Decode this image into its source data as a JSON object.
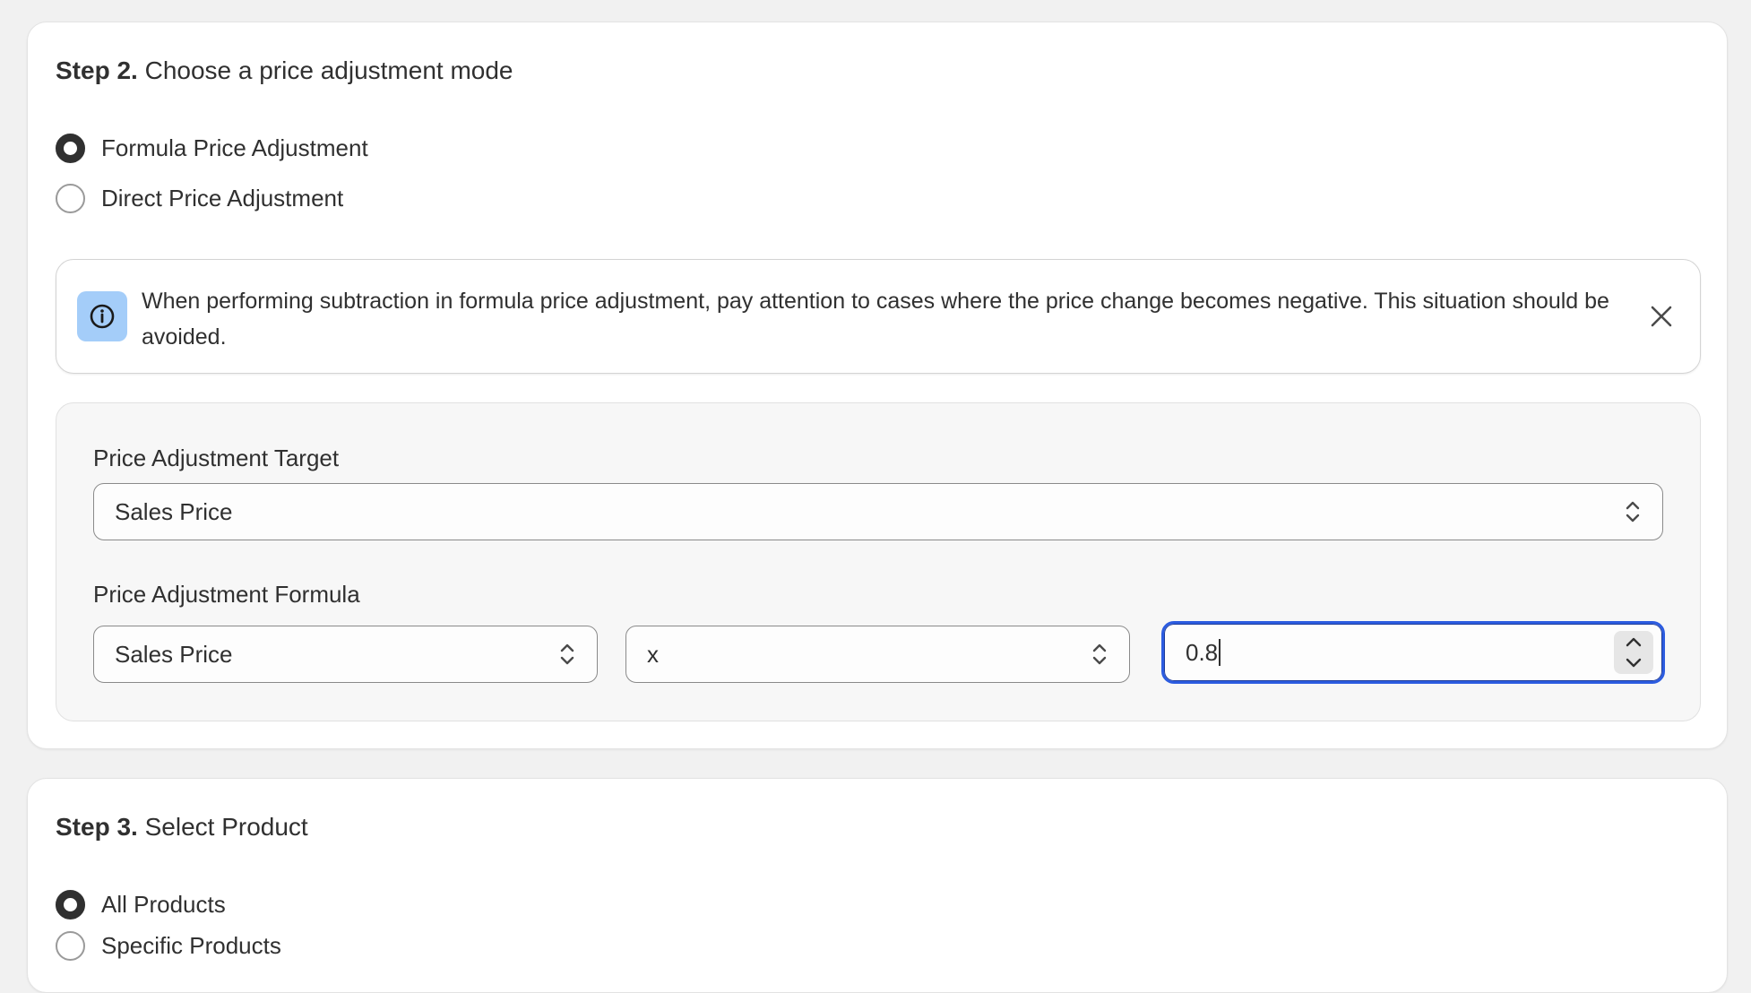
{
  "step2": {
    "number": "Step 2.",
    "title": "Choose a price adjustment mode",
    "options": [
      {
        "label": "Formula Price Adjustment",
        "checked": true
      },
      {
        "label": "Direct Price Adjustment",
        "checked": false
      }
    ],
    "banner": {
      "icon": "info-icon",
      "text": "When performing subtraction in formula price adjustment, pay attention to cases where the price change becomes negative. This situation should be avoided.",
      "close_icon": "close-icon"
    },
    "target": {
      "label": "Price Adjustment Target",
      "value": "Sales Price"
    },
    "formula": {
      "label": "Price Adjustment Formula",
      "base": "Sales Price",
      "operator": "x",
      "value": "0.8"
    }
  },
  "step3": {
    "number": "Step 3.",
    "title": "Select Product",
    "options": [
      {
        "label": "All Products",
        "checked": true
      },
      {
        "label": "Specific Products",
        "checked": false
      }
    ]
  },
  "colors": {
    "page_bg": "#f1f1f1",
    "info_icon_bg": "#a4cdf9",
    "focus_ring": "#2c5ce0",
    "text": "#303030"
  }
}
